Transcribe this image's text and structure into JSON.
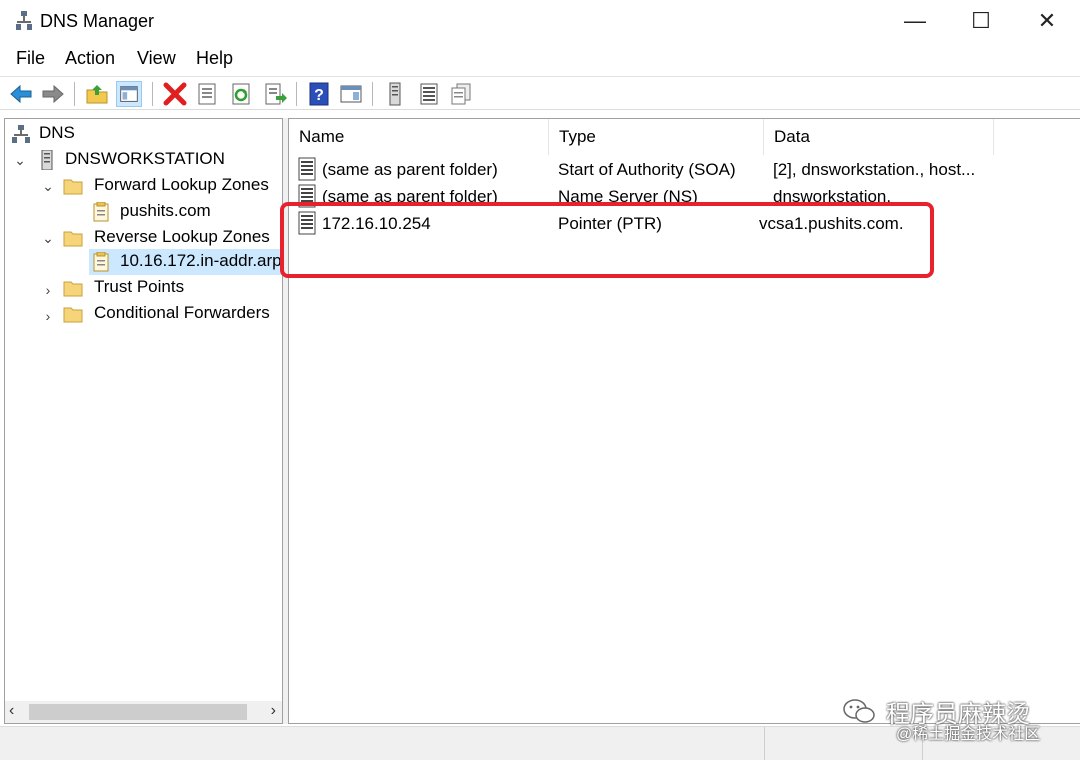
{
  "window": {
    "title": "DNS Manager",
    "controls": {
      "minimize": "—",
      "maximize": "☐",
      "close": "✕"
    }
  },
  "menu": [
    "File",
    "Action",
    "View",
    "Help"
  ],
  "toolbar": {
    "icons": [
      "back-arrow-icon",
      "forward-arrow-icon",
      "up-folder-icon",
      "show-hide-console-tree-icon",
      "delete-icon",
      "properties-icon",
      "refresh-icon",
      "export-list-icon",
      "help-icon",
      "show-action-pane-icon",
      "server-icon",
      "record-list-icon",
      "copy-icon"
    ]
  },
  "tree": {
    "root": "DNS",
    "server": "DNSWORKSTATION",
    "forward_zones": "Forward Lookup Zones",
    "forward_child": "pushits.com",
    "reverse_zones": "Reverse Lookup Zones",
    "reverse_child": "10.16.172.in-addr.arp",
    "trust_points": "Trust Points",
    "conditional_forwarders": "Conditional Forwarders",
    "expander_open": "⌄",
    "expander_closed": "›"
  },
  "scrollbar": {
    "left": "‹",
    "right": "›"
  },
  "columns": {
    "name": "Name",
    "type": "Type",
    "data": "Data"
  },
  "records": [
    {
      "name": "(same as parent folder)",
      "type": "Start of Authority (SOA)",
      "data": "[2], dnsworkstation., host..."
    },
    {
      "name": "(same as parent folder)",
      "type": "Name Server (NS)",
      "data": "dnsworkstation."
    },
    {
      "name": "172.16.10.254",
      "type": "Pointer (PTR)",
      "data": "vcsa1.pushits.com."
    }
  ],
  "watermark": {
    "line1": "程序员麻辣烫",
    "line2": "@稀土掘金技术社区"
  },
  "colors": {
    "highlight_box": "#e8222d",
    "selection": "#cce8ff"
  }
}
